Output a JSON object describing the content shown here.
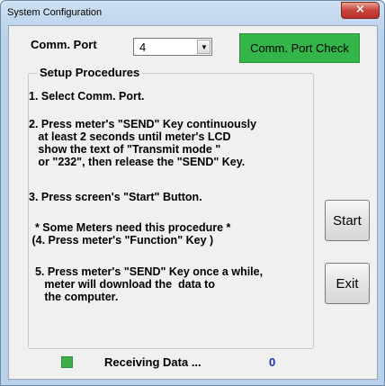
{
  "window": {
    "title": "System Configuration",
    "close_icon": "×"
  },
  "port": {
    "label": "Comm. Port",
    "value": "4",
    "dropdown_icon": "▼"
  },
  "check_button": {
    "label": "Comm. Port Check",
    "color": "#34b54a"
  },
  "procedures": {
    "title": "Setup Procedures",
    "steps": [
      "1. Select Comm. Port.",
      "2. Press meter's \"SEND\" Key continuously\n   at least 2 seconds until meter's LCD\n   show the text of \"Transmit mode \"\n   or \"232\", then release the \"SEND\" Key.",
      "3. Press screen's \"Start\" Button.",
      "  * Some Meters need this procedure *\n (4. Press meter's \"Function\" Key )",
      "  5. Press meter's \"SEND\" Key once a while,\n     meter will download the  data to\n     the computer."
    ]
  },
  "buttons": {
    "start": "Start",
    "exit": "Exit"
  },
  "status": {
    "text": "Receiving Data ...",
    "count": "0",
    "led_color": "#3fae4a"
  }
}
